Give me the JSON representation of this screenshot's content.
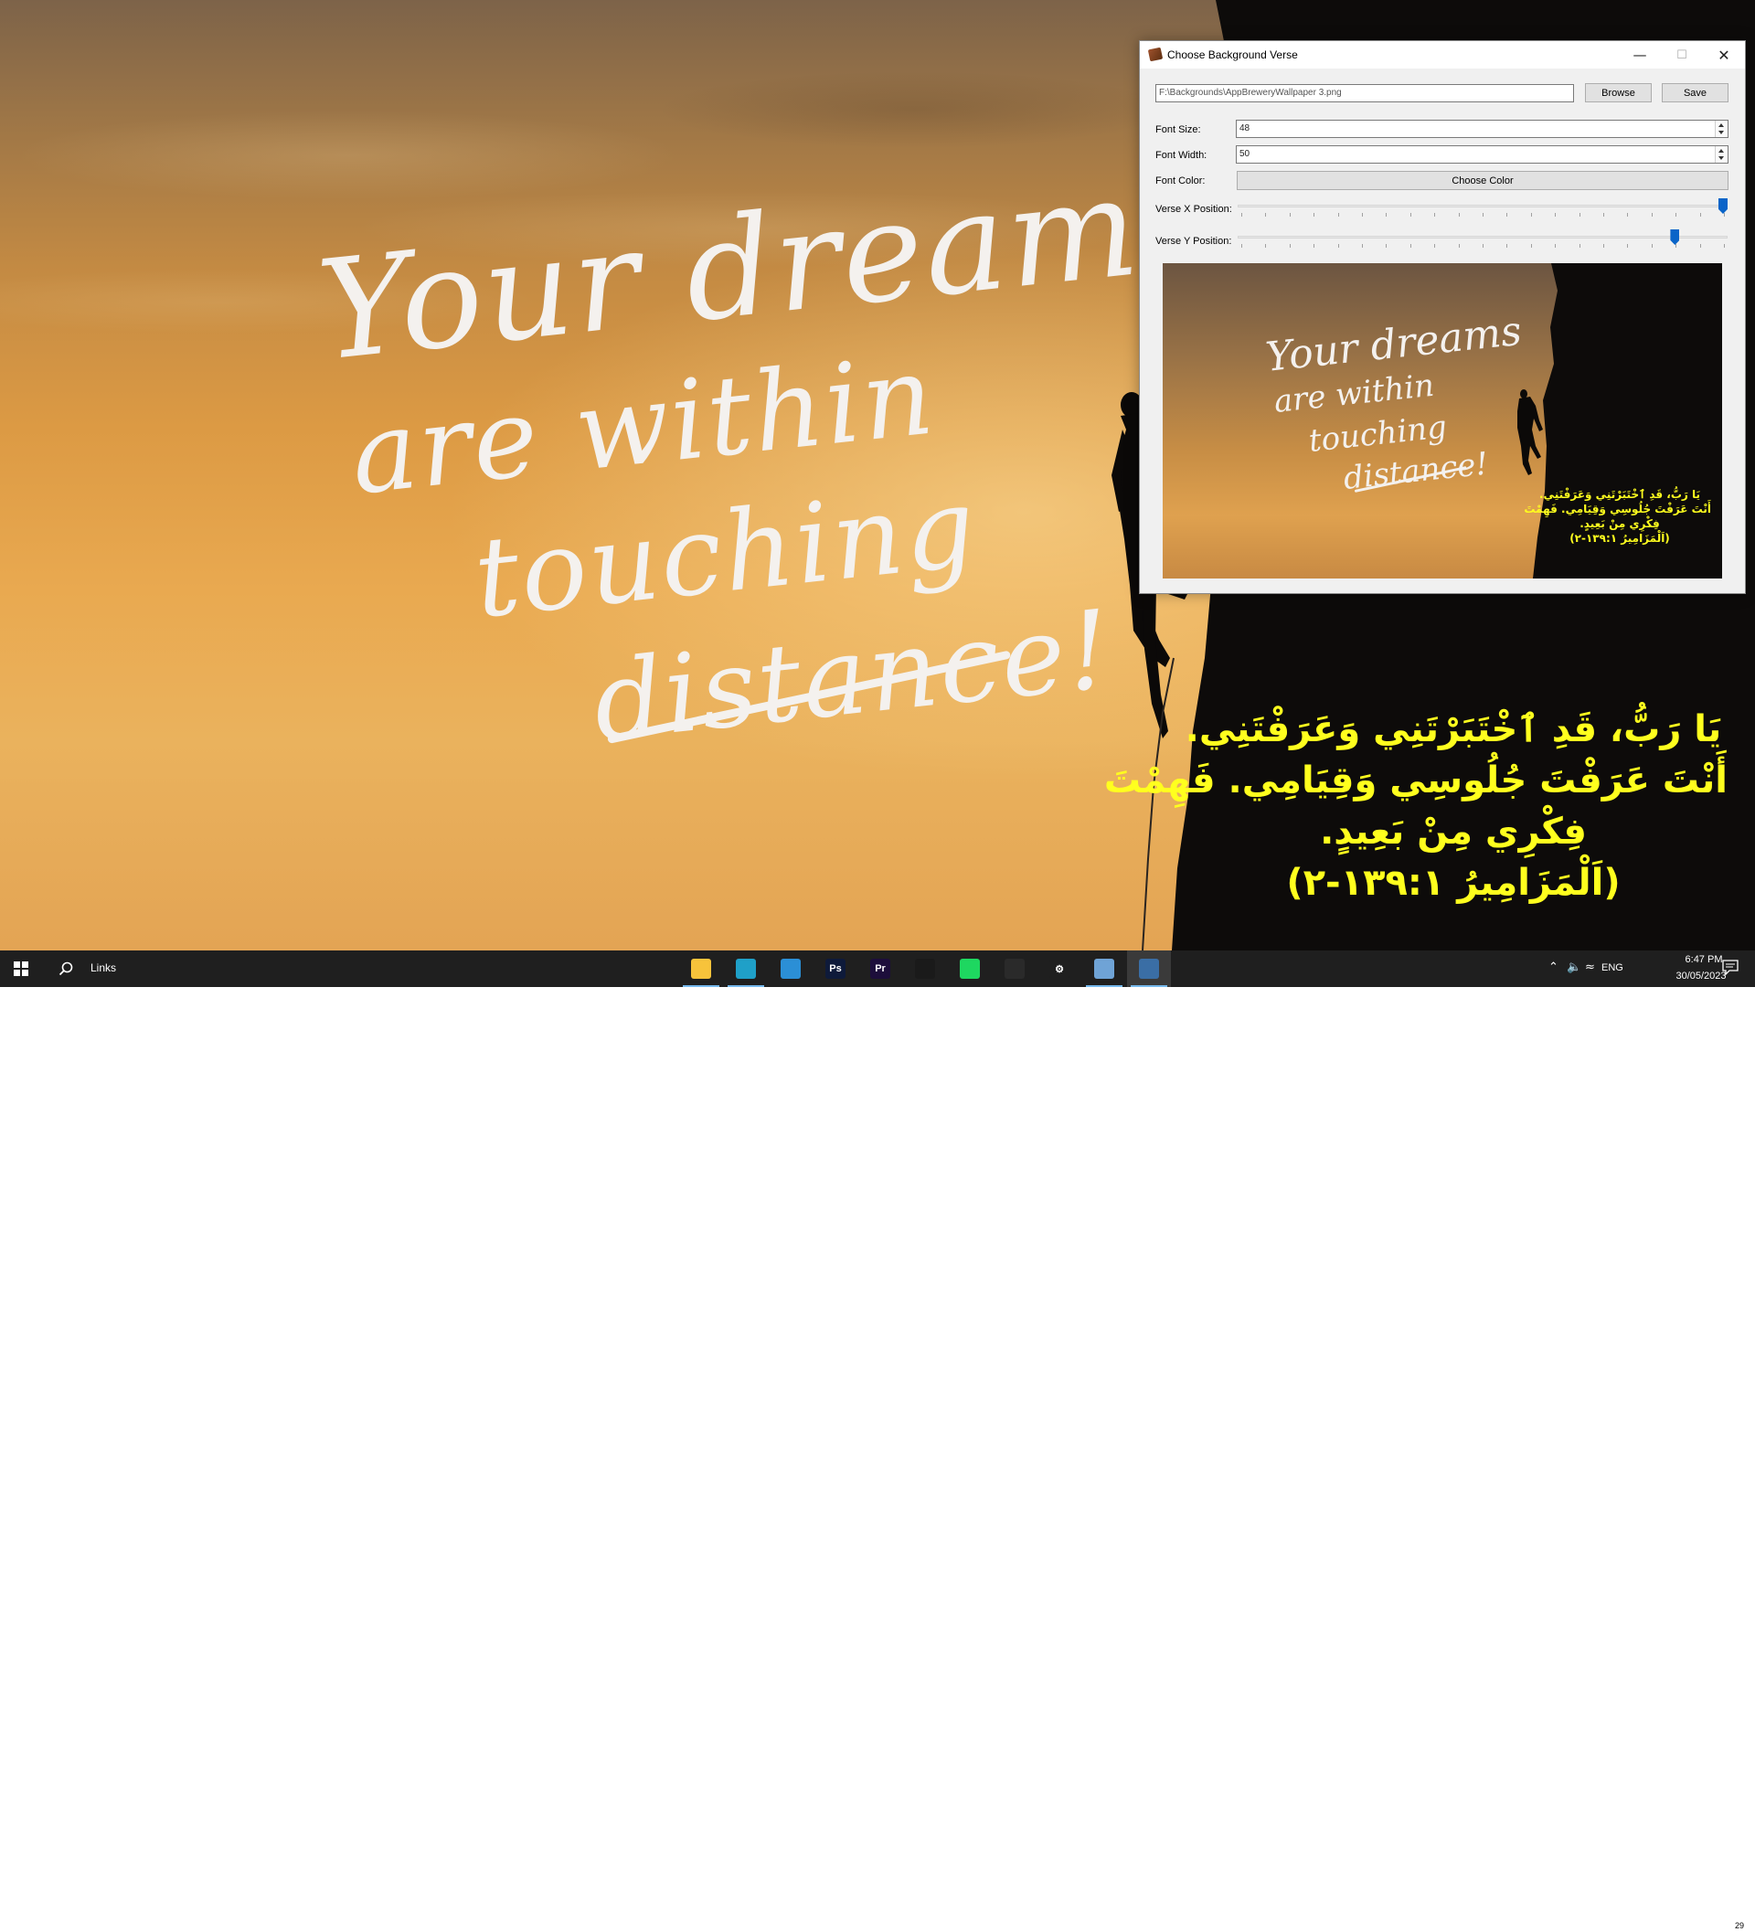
{
  "wallpaper": {
    "quote_lines": [
      "Your dreams",
      "are within",
      "touching",
      "distance!"
    ],
    "verse_lines": [
      "يَا رَبُّ، قَدِ ٱخْتَبَرْتَنِي وَعَرَفْتَنِي.",
      "أَنْتَ عَرَفْتَ جُلُوسِي وَقِيَامِي. فَهِمْتَ",
      "فِكْرِي مِنْ بَعِيدٍ.",
      "(اَلْمَزَامِيرُ ١٣٩:١-٢)"
    ],
    "verse_color": "#ffff1e"
  },
  "window": {
    "title": "Choose Background Verse",
    "minimize_glyph": "—",
    "maximize_glyph": "☐",
    "close_glyph": "✕",
    "path_value": "F:\\Backgrounds\\AppBreweryWallpaper 3.png",
    "browse_label": "Browse",
    "save_label": "Save",
    "font_size_label": "Font Size:",
    "font_size_value": "48",
    "font_width_label": "Font Width:",
    "font_width_value": "50",
    "font_color_label": "Font Color:",
    "choose_color_label": "Choose Color",
    "verse_x_label": "Verse X Position:",
    "verse_x_level": 1.0,
    "verse_y_label": "Verse Y Position:",
    "verse_y_level": 0.9,
    "accent_color": "#0a64c8"
  },
  "taskbar": {
    "links_label": "Links",
    "apps": [
      {
        "name": "file-explorer",
        "glyph": "",
        "color": "#f7c33b",
        "state": "open"
      },
      {
        "name": "edge",
        "glyph": "",
        "color": "#1fa0c8",
        "state": "open"
      },
      {
        "name": "vscode",
        "glyph": "",
        "color": "#2b8fd6",
        "state": "none"
      },
      {
        "name": "photoshop",
        "glyph": "Ps",
        "color": "#0e1a3a",
        "state": "none"
      },
      {
        "name": "premiere",
        "glyph": "Pr",
        "color": "#1d0e3b",
        "state": "none"
      },
      {
        "name": "acrobat",
        "glyph": "",
        "color": "#1a1a1a",
        "state": "none"
      },
      {
        "name": "spotify",
        "glyph": "",
        "color": "#1ed760",
        "state": "none"
      },
      {
        "name": "whatsapp",
        "glyph": "",
        "color": "#2a2a2a",
        "state": "none"
      },
      {
        "name": "settings",
        "glyph": "⚙",
        "color": "#1f1f1f",
        "state": "none"
      },
      {
        "name": "image-editor",
        "glyph": "",
        "color": "#6fa3d6",
        "state": "open"
      },
      {
        "name": "python",
        "glyph": "",
        "color": "#3a6ea5",
        "state": "focused"
      }
    ],
    "language": "ENG",
    "time": "6:47 PM",
    "date": "30/05/2023",
    "notification_count": "29"
  }
}
